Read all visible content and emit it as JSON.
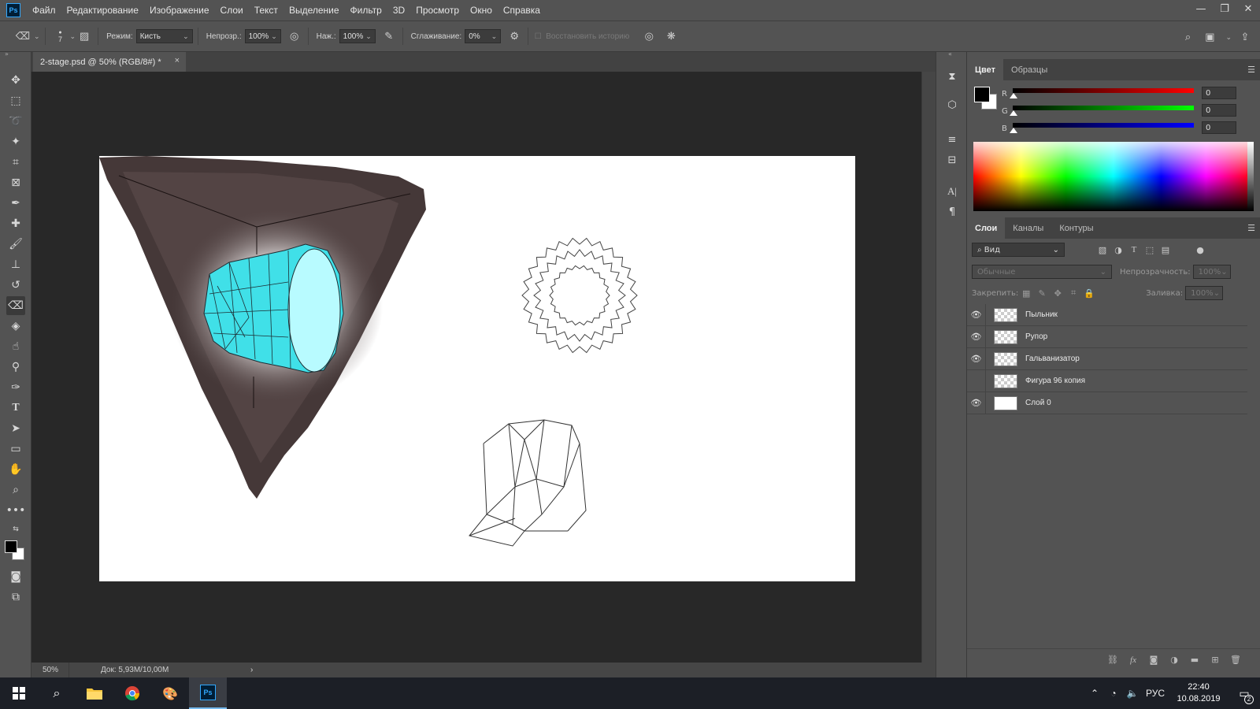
{
  "menubar": {
    "logo": "Ps",
    "items": [
      "Файл",
      "Редактирование",
      "Изображение",
      "Слои",
      "Текст",
      "Выделение",
      "Фильтр",
      "3D",
      "Просмотр",
      "Окно",
      "Справка"
    ],
    "window_controls": [
      "—",
      "❐",
      "✕"
    ]
  },
  "options": {
    "brush_size": "7",
    "mode_label": "Режим:",
    "mode_value": "Кисть",
    "opacity_label": "Непрозр.:",
    "opacity_value": "100%",
    "pressure_label": "Наж.:",
    "pressure_value": "100%",
    "smoothing_label": "Сглаживание:",
    "smoothing_value": "0%",
    "restore_history_label": "Восстановить историю"
  },
  "document": {
    "tab_title": "2-stage.psd @ 50% (RGB/8#) *",
    "tab_close": "×",
    "zoom": "50%",
    "doc_info": "Док: 5,93M/10,00M",
    "status_arrow": "›"
  },
  "color_panel": {
    "tabs": [
      "Цвет",
      "Образцы"
    ],
    "channels": [
      {
        "label": "R",
        "value": "0",
        "color": "#ff0000"
      },
      {
        "label": "G",
        "value": "0",
        "color": "#00ff00"
      },
      {
        "label": "B",
        "value": "0",
        "color": "#0000ff"
      }
    ]
  },
  "layers_panel": {
    "tabs": [
      "Слои",
      "Каналы",
      "Контуры"
    ],
    "filter_value": "Вид",
    "blend_mode": "Обычные",
    "opacity_label": "Непрозрачность:",
    "opacity_value": "100%",
    "lock_label": "Закрепить:",
    "fill_label": "Заливка:",
    "fill_value": "100%",
    "layers": [
      {
        "name": "Пыльник",
        "visible": true,
        "thumb": "transparent"
      },
      {
        "name": "Рупор",
        "visible": true,
        "thumb": "transparent"
      },
      {
        "name": "Гальванизатор",
        "visible": true,
        "thumb": "transparent"
      },
      {
        "name": "Фигура 96 копия",
        "visible": false,
        "thumb": "transparent"
      },
      {
        "name": "Слой 0",
        "visible": true,
        "thumb": "white"
      }
    ],
    "footer_icons": [
      "link-icon",
      "fx-icon",
      "mask-icon",
      "adjustment-icon",
      "folder-icon",
      "new-layer-icon",
      "trash-icon"
    ]
  },
  "taskbar": {
    "language": "РУС",
    "time": "22:40",
    "date": "10.08.2019",
    "notifications": "2"
  },
  "colors": {
    "accent": "#31a8ff",
    "rock": "#4d3f3f",
    "crystal": "#40e0e8"
  }
}
